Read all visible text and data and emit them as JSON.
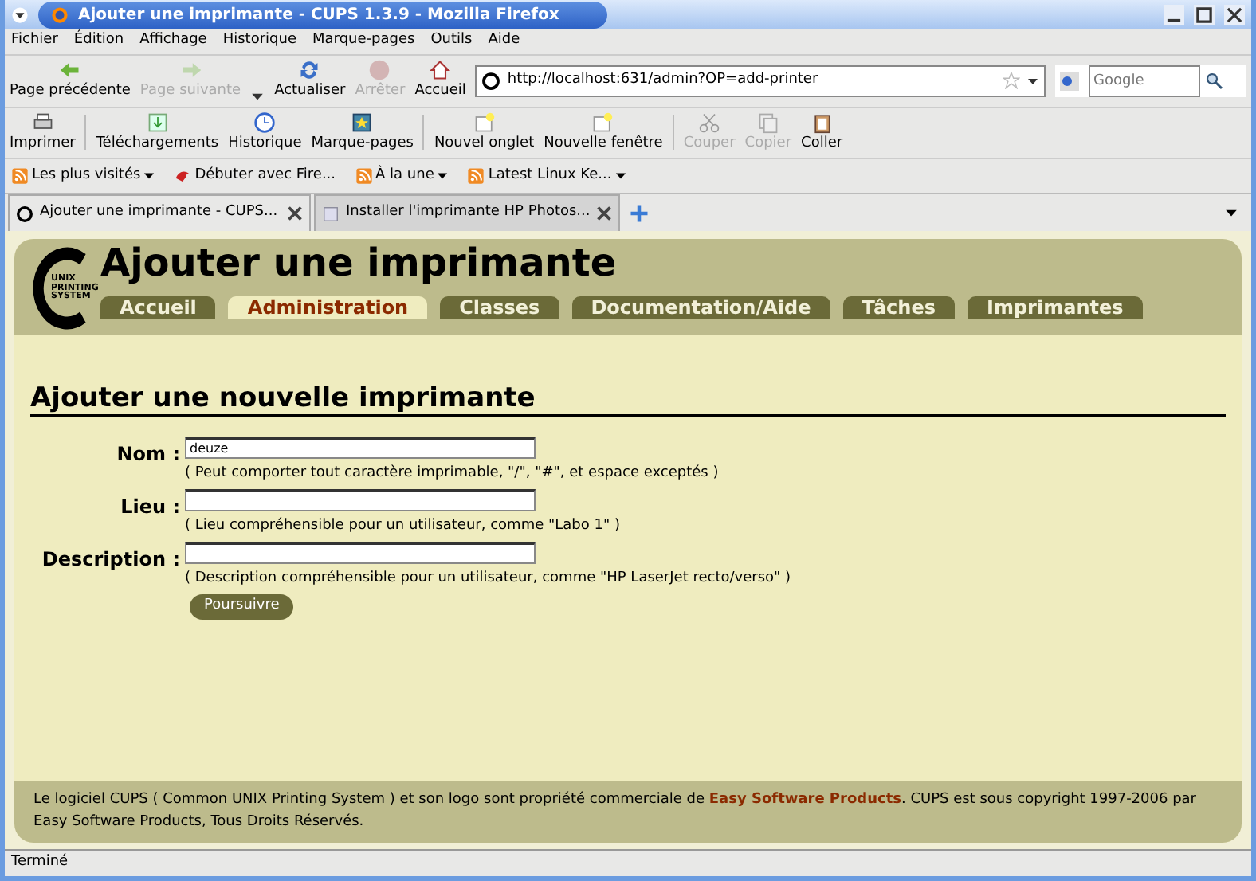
{
  "window": {
    "title": "Ajouter une imprimante - CUPS 1.3.9 - Mozilla Firefox"
  },
  "menu": [
    "Fichier",
    "Édition",
    "Affichage",
    "Historique",
    "Marque-pages",
    "Outils",
    "Aide"
  ],
  "nav_toolbar": [
    {
      "label": "Page précédente",
      "kind": "back",
      "disabled": false
    },
    {
      "label": "Page suivante",
      "kind": "forward",
      "disabled": true
    },
    {
      "label": "Actualiser",
      "kind": "reload",
      "disabled": false
    },
    {
      "label": "Arrêter",
      "kind": "stop",
      "disabled": true
    },
    {
      "label": "Accueil",
      "kind": "home",
      "disabled": false
    }
  ],
  "address": {
    "value": "http://localhost:631/admin?OP=add-printer"
  },
  "search": {
    "placeholder": "Google"
  },
  "toolbar": [
    {
      "label": "Imprimer",
      "kind": "print",
      "disabled": false
    },
    {
      "label": "Téléchargements",
      "kind": "download",
      "disabled": false
    },
    {
      "label": "Historique",
      "kind": "clock",
      "disabled": false
    },
    {
      "label": "Marque-pages",
      "kind": "bookmark",
      "disabled": false
    },
    {
      "label": "Nouvel onglet",
      "kind": "newtab",
      "disabled": false
    },
    {
      "label": "Nouvelle fenêtre",
      "kind": "newtab",
      "disabled": false
    },
    {
      "label": "Couper",
      "kind": "cut",
      "disabled": true
    },
    {
      "label": "Copier",
      "kind": "copy",
      "disabled": true
    },
    {
      "label": "Coller",
      "kind": "paste",
      "disabled": false
    }
  ],
  "bookmarks": [
    {
      "label": "Les plus visités",
      "kind": "feed",
      "dropdown": true
    },
    {
      "label": "Débuter avec Fire...",
      "kind": "page",
      "dropdown": false
    },
    {
      "label": "À la une",
      "kind": "feed",
      "dropdown": true
    },
    {
      "label": "Latest Linux Ke...",
      "kind": "feed",
      "dropdown": true
    }
  ],
  "tabs": [
    {
      "label": "Ajouter une imprimante - CUPS...",
      "selected": true
    },
    {
      "label": "Installer l'imprimante HP Photos...",
      "selected": false
    }
  ],
  "page": {
    "logo_lines": [
      "UNIX",
      "PRINTING",
      "SYSTEM"
    ],
    "title": "Ajouter une imprimante",
    "nav": [
      {
        "label": "Accueil",
        "selected": false
      },
      {
        "label": "Administration",
        "selected": true
      },
      {
        "label": "Classes",
        "selected": false
      },
      {
        "label": "Documentation/Aide",
        "selected": false
      },
      {
        "label": "Tâches",
        "selected": false
      },
      {
        "label": "Imprimantes",
        "selected": false
      }
    ],
    "heading": "Ajouter une nouvelle imprimante",
    "fields": [
      {
        "label": "Nom :",
        "value": "deuze",
        "hint": "( Peut comporter tout caractère imprimable, \"/\", \"#\", et espace exceptés )"
      },
      {
        "label": "Lieu :",
        "hint": "( Lieu compréhensible pour un utilisateur, comme \"Labo 1\" )"
      },
      {
        "label": "Description :",
        "hint": "( Description compréhensible pour un utilisateur, comme \"HP LaserJet recto/verso\" )"
      }
    ],
    "submit": "Poursuivre",
    "footer": {
      "before": "Le logiciel CUPS ( Common UNIX Printing System ) et son logo sont propriété commerciale de",
      "link": "Easy Software Products",
      "after": ". CUPS est sous copyright 1997-2006 par Easy Software Products, Tous Droits Réservés."
    }
  },
  "status_bar": "Terminé"
}
